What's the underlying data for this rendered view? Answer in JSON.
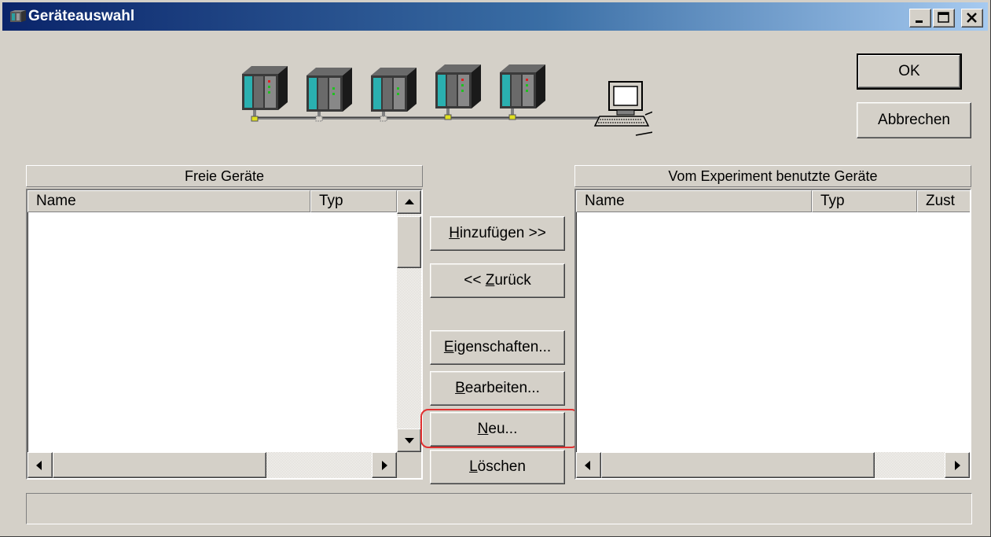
{
  "window": {
    "title": "Geräteauswahl",
    "controls": [
      "minimize-icon",
      "maximize-icon",
      "close-icon"
    ]
  },
  "dialog_buttons": {
    "ok": "OK",
    "cancel": "Abbrechen"
  },
  "free_devices": {
    "header": "Freie Geräte",
    "columns": [
      "Name",
      "Typ"
    ],
    "rows": []
  },
  "used_devices": {
    "header": "Vom Experiment benutzte Geräte",
    "columns": [
      "Name",
      "Typ",
      "Zust"
    ],
    "rows": []
  },
  "actions": {
    "add": {
      "mnemonic": "H",
      "rest": "inzufügen >>"
    },
    "back": {
      "prefix": "<< ",
      "mnemonic": "Z",
      "rest": "urück"
    },
    "properties": {
      "mnemonic": "E",
      "rest": "igenschaften..."
    },
    "edit": {
      "mnemonic": "B",
      "rest": "earbeiten..."
    },
    "new": {
      "mnemonic": "N",
      "rest": "eu..."
    },
    "delete": {
      "mnemonic": "L",
      "rest": "öschen"
    }
  },
  "highlight": {
    "target": "new-button",
    "color": "#e03030"
  },
  "status": {
    "text": ""
  },
  "network_illustration": {
    "device_count": 5,
    "icons": [
      "device-module-icon",
      "computer-icon"
    ]
  }
}
